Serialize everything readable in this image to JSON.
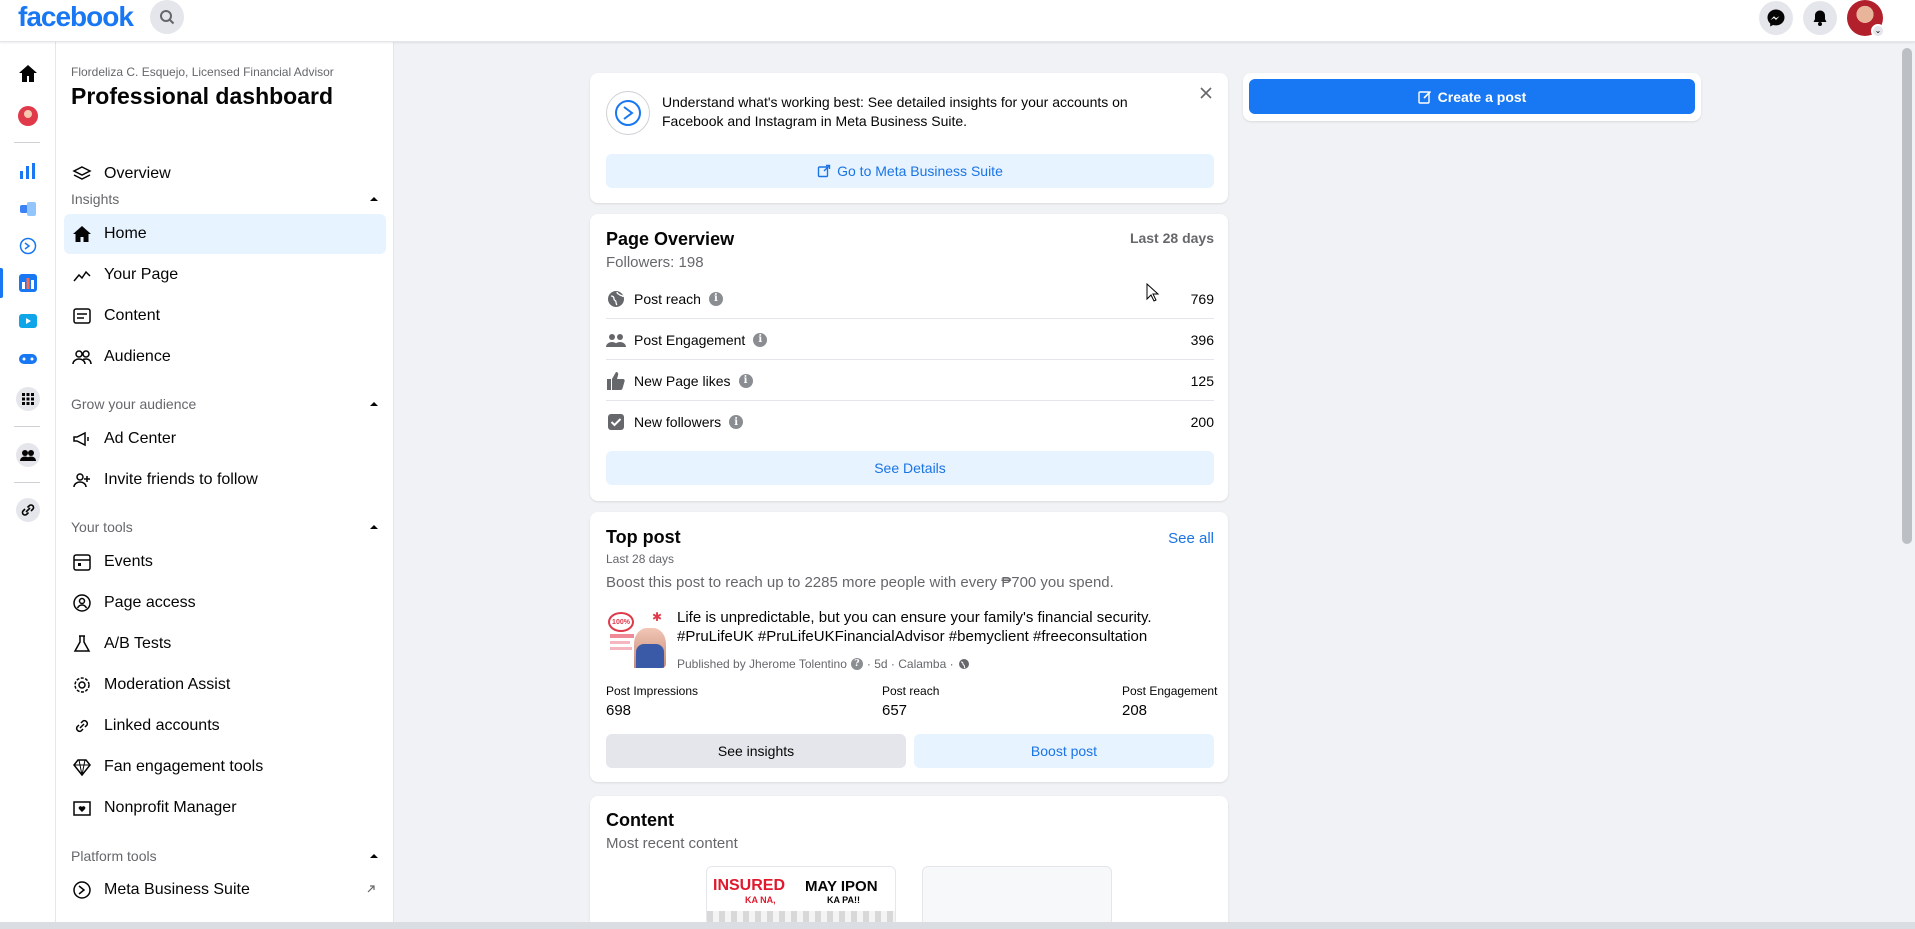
{
  "brand": {
    "logo_text": "facebook",
    "color": "#1877f2"
  },
  "topbar": {
    "search_icon": "search-icon",
    "messenger_icon": "messenger-icon",
    "notifications_icon": "bell-icon",
    "account_caret": "⌄"
  },
  "sidebar": {
    "subtitle": "Flordeliza C. Esquejo, Licensed Financial Advisor",
    "title": "Professional dashboard",
    "overview": "Overview",
    "insights_header": "Insights",
    "insights_items": [
      "Home",
      "Your Page",
      "Content",
      "Audience"
    ],
    "grow_header": "Grow your audience",
    "grow_items": [
      "Ad Center",
      "Invite friends to follow"
    ],
    "tools_header": "Your tools",
    "tools_items": [
      "Events",
      "Page access",
      "A/B Tests",
      "Moderation Assist",
      "Linked accounts",
      "Fan engagement tools",
      "Nonprofit Manager"
    ],
    "platform_header": "Platform tools",
    "platform_items": [
      "Meta Business Suite"
    ]
  },
  "banner": {
    "text": "Understand what's working best: See detailed insights for your accounts on Facebook and Instagram in Meta Business Suite.",
    "button": "Go to Meta Business Suite"
  },
  "create_post": {
    "label": "Create a post"
  },
  "page_overview": {
    "title": "Page Overview",
    "range": "Last 28 days",
    "followers": "Followers: 198",
    "metrics": [
      {
        "label": "Post reach",
        "value": "769",
        "icon": "globe-icon"
      },
      {
        "label": "Post Engagement",
        "value": "396",
        "icon": "people-icon"
      },
      {
        "label": "New Page likes",
        "value": "125",
        "icon": "thumbs-up-icon"
      },
      {
        "label": "New followers",
        "value": "200",
        "icon": "check-square-icon"
      }
    ],
    "details_button": "See Details"
  },
  "top_post": {
    "title": "Top post",
    "see_all": "See all",
    "range": "Last 28 days",
    "boost_hint": "Boost this post to reach up to 2285 more people with every ₱700 you spend.",
    "post_text": "Life is unpredictable, but you can ensure your family's financial security. #PruLifeUK #PruLifeUKFinancialAdvisor #bemyclient #freeconsultation",
    "published": "Published by Jherome Tolentino",
    "meta": "· 5d · Calamba ·",
    "thumb_badge": "100%",
    "stats": [
      {
        "label": "Post Impressions",
        "value": "698"
      },
      {
        "label": "Post reach",
        "value": "657"
      },
      {
        "label": "Post Engagement",
        "value": "208"
      }
    ],
    "insights_button": "See insights",
    "boost_button": "Boost post"
  },
  "content": {
    "title": "Content",
    "subtitle": "Most recent content",
    "thumb_text_1": "INSURED",
    "thumb_text_2": "MAY IPON",
    "thumb_text_3": "KA NA,",
    "thumb_text_4": "KA PA!!"
  }
}
